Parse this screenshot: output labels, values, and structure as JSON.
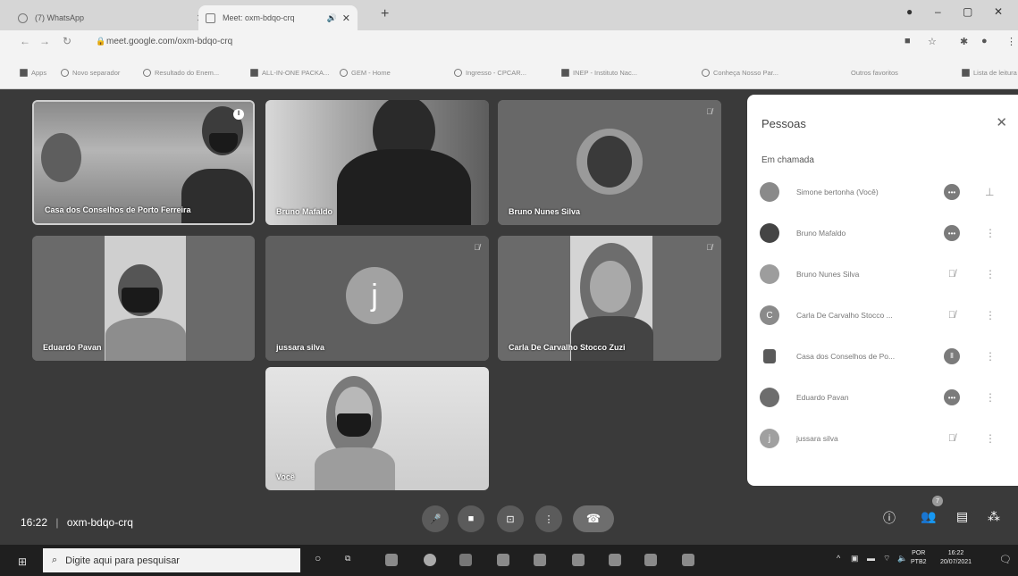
{
  "browser": {
    "tabs": [
      {
        "title": "(7) WhatsApp",
        "active": false
      },
      {
        "title": "Meet: oxm-bdqo-crq",
        "active": true
      }
    ],
    "url": "meet.google.com/oxm-bdqo-crq",
    "bookmarks": [
      "Apps",
      "Novo separador",
      "Resultado do Enem...",
      "ALL-IN-ONE PACKA...",
      "GEM - Home",
      "Ingresso - CPCAR...",
      "INEP - Instituto Nac...",
      "Conheça Nosso Par...",
      "Outros favoritos",
      "Lista de leitura"
    ]
  },
  "meet": {
    "tiles": [
      {
        "name": "Casa dos Conselhos de Porto Ferreira",
        "status": "speaking"
      },
      {
        "name": "Bruno Mafaldo",
        "status": ""
      },
      {
        "name": "Bruno Nunes Silva",
        "status": "muted"
      },
      {
        "name": "Eduardo Pavan",
        "status": ""
      },
      {
        "name": "jussara silva",
        "status": "muted",
        "initial": "j"
      },
      {
        "name": "Carla De Carvalho Stocco Zuzi",
        "status": "muted"
      },
      {
        "name": "Você",
        "status": ""
      }
    ],
    "clock": "16:22",
    "meeting_code": "oxm-bdqo-crq",
    "participants_badge": "7"
  },
  "panel": {
    "title": "Pessoas",
    "section": "Em chamada",
    "people": [
      {
        "name": "Simone bertonha (Você)",
        "status": "active"
      },
      {
        "name": "Bruno Mafaldo",
        "status": "active"
      },
      {
        "name": "Bruno Nunes Silva",
        "status": "muted"
      },
      {
        "name": "Carla De Carvalho Stocco ...",
        "status": "muted",
        "initial": "C"
      },
      {
        "name": "Casa dos Conselhos de Po...",
        "status": "speaking"
      },
      {
        "name": "Eduardo Pavan",
        "status": "active"
      },
      {
        "name": "jussara silva",
        "status": "muted",
        "initial": "j"
      }
    ]
  },
  "taskbar": {
    "search_placeholder": "Digite aqui para pesquisar",
    "lang_top": "POR",
    "lang_bottom": "PTB2",
    "time": "16:22",
    "date": "20/07/2021"
  }
}
